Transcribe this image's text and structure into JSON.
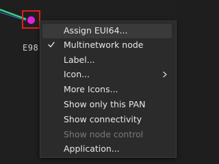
{
  "node": {
    "label": "E98"
  },
  "context_menu": {
    "items": [
      {
        "label": "Assign EUI64...",
        "checked": false,
        "submenu": false,
        "enabled": true,
        "highlighted": true
      },
      {
        "label": "Multinetwork node",
        "checked": true,
        "submenu": false,
        "enabled": true,
        "highlighted": false
      },
      {
        "label": "Label...",
        "checked": false,
        "submenu": false,
        "enabled": true,
        "highlighted": false
      },
      {
        "label": "Icon...",
        "checked": false,
        "submenu": true,
        "enabled": true,
        "highlighted": false
      },
      {
        "label": "More Icons...",
        "checked": false,
        "submenu": false,
        "enabled": true,
        "highlighted": false
      },
      {
        "label": "Show only this PAN",
        "checked": false,
        "submenu": false,
        "enabled": true,
        "highlighted": false
      },
      {
        "label": "Show connectivity",
        "checked": false,
        "submenu": false,
        "enabled": true,
        "highlighted": false
      },
      {
        "label": "Show node control",
        "checked": false,
        "submenu": false,
        "enabled": false,
        "highlighted": false
      },
      {
        "label": "Application...",
        "checked": false,
        "submenu": false,
        "enabled": true,
        "highlighted": false
      }
    ]
  },
  "colors": {
    "background": "#1f1f1f",
    "menu_background": "#2b2b2b",
    "menu_highlight": "#3a3a3a",
    "selection_border": "#e21c1c",
    "node_dot": "#e020e0",
    "link_line": "#3fd18a"
  },
  "icons": {
    "check": "check-icon",
    "submenu": "chevron-right-icon"
  }
}
